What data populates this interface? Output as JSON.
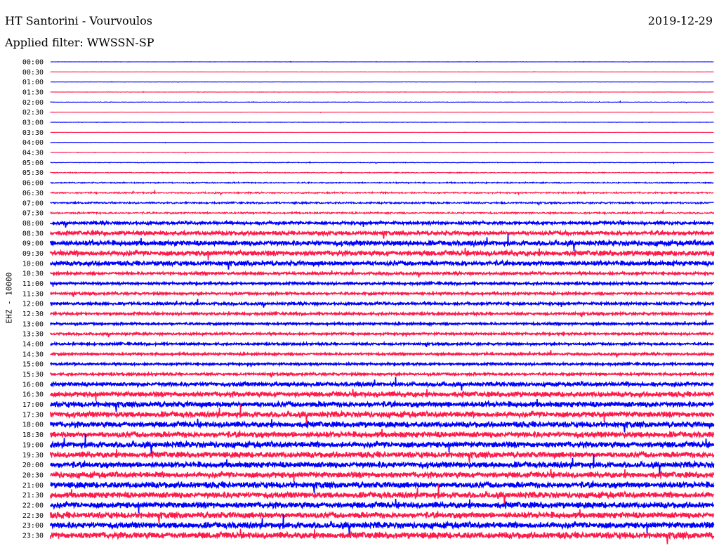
{
  "header": {
    "station": "HT Santorini - Vourvoulos",
    "date": "2019-12-29",
    "filter": "Applied filter: WWSSN-SP"
  },
  "channel_label": "EHZ - 10000",
  "colors": {
    "even_row": "#0000ff",
    "odd_row": "#ff1a4b",
    "background": "#ffffff"
  },
  "chart_data": {
    "type": "helicorder",
    "title": "HT Santorini - Vourvoulos",
    "date": "2019-12-29",
    "filter": "WWSSN-SP",
    "channel": "EHZ - 10000",
    "row_labels": [
      "00:00",
      "00:30",
      "01:00",
      "01:30",
      "02:00",
      "02:30",
      "03:00",
      "03:30",
      "04:00",
      "04:30",
      "05:00",
      "05:30",
      "06:00",
      "06:30",
      "07:00",
      "07:30",
      "08:00",
      "08:30",
      "09:00",
      "09:30",
      "10:00",
      "10:30",
      "11:00",
      "11:30",
      "12:00",
      "12:30",
      "13:00",
      "13:30",
      "14:00",
      "14:30",
      "15:00",
      "15:30",
      "16:00",
      "16:30",
      "17:00",
      "17:30",
      "18:00",
      "18:30",
      "19:00",
      "19:30",
      "20:00",
      "20:30",
      "21:00",
      "21:30",
      "22:00",
      "22:30",
      "23:00",
      "23:30"
    ],
    "row_colors": [
      "blue",
      "red"
    ],
    "noise_level": [
      0.15,
      0.12,
      0.12,
      0.2,
      0.25,
      0.15,
      0.2,
      0.12,
      0.18,
      0.25,
      0.35,
      0.45,
      0.7,
      0.9,
      1.0,
      1.0,
      1.6,
      2.2,
      2.8,
      2.8,
      2.5,
      1.4,
      1.3,
      1.3,
      1.4,
      1.3,
      1.2,
      1.2,
      1.2,
      1.2,
      1.2,
      1.3,
      2.2,
      2.8,
      3.0,
      3.1,
      3.1,
      3.2,
      3.2,
      3.2,
      3.2,
      3.2,
      3.3,
      3.3,
      3.3,
      3.3,
      3.4,
      3.5
    ]
  }
}
